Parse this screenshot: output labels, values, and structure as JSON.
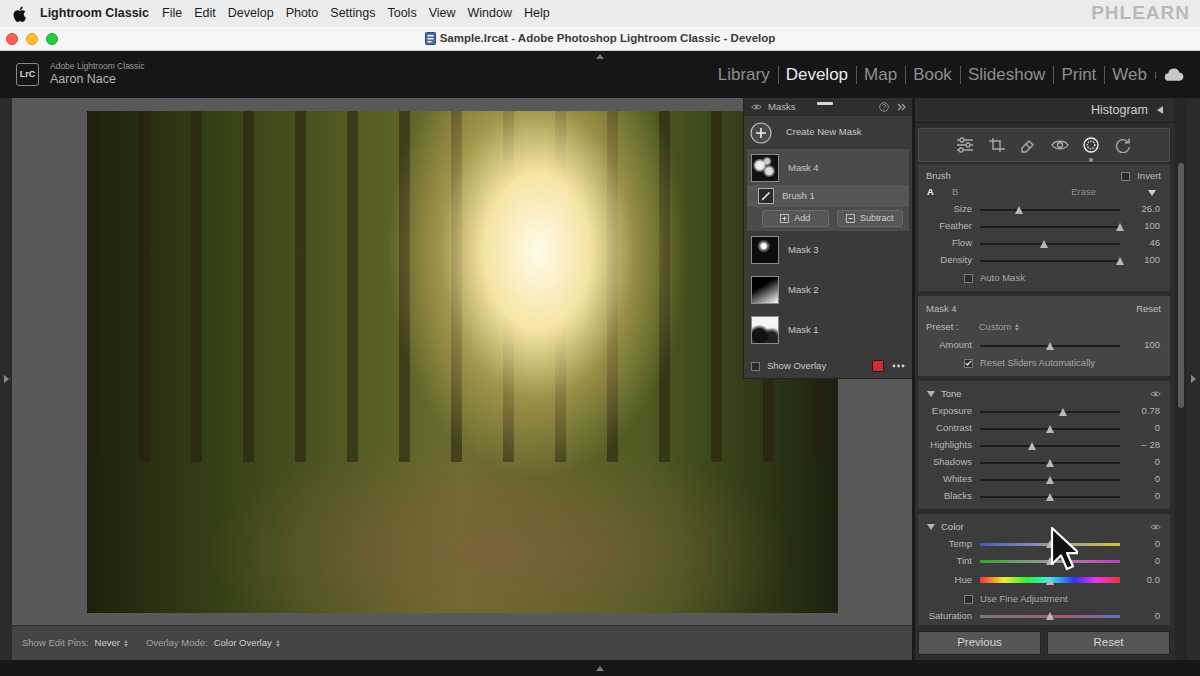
{
  "menubar": {
    "app": "Lightroom Classic",
    "items": [
      "File",
      "Edit",
      "Develop",
      "Photo",
      "Settings",
      "Tools",
      "View",
      "Window",
      "Help"
    ],
    "watermark": "PHLEARN"
  },
  "window": {
    "title": "Sample.lrcat - Adobe Photoshop Lightroom Classic - Develop"
  },
  "identity": {
    "logo": "LrC",
    "product": "Adobe Lightroom Classic",
    "user": "Aaron Nace"
  },
  "modules": [
    {
      "label": "Library",
      "selected": false
    },
    {
      "label": "Develop",
      "selected": true
    },
    {
      "label": "Map",
      "selected": false
    },
    {
      "label": "Book",
      "selected": false
    },
    {
      "label": "Slideshow",
      "selected": false
    },
    {
      "label": "Print",
      "selected": false
    },
    {
      "label": "Web",
      "selected": false
    }
  ],
  "masks_panel": {
    "title": "Masks",
    "create": "Create New Mask",
    "masks": [
      {
        "name": "Mask 4",
        "selected": true,
        "components": [
          {
            "name": "Brush 1",
            "selected": true
          }
        ]
      },
      {
        "name": "Mask 3",
        "selected": false,
        "components": []
      },
      {
        "name": "Mask 2",
        "selected": false,
        "components": []
      },
      {
        "name": "Mask 1",
        "selected": false,
        "components": []
      }
    ],
    "add": "Add",
    "subtract": "Subtract",
    "show_overlay": {
      "label": "Show Overlay",
      "checked": false
    }
  },
  "toolbar": {
    "pins_label": "Show Edit Pins:",
    "pins_value": "Never",
    "overlay_label": "Overlay Mode:",
    "overlay_value": "Color Overlay"
  },
  "right_panel": {
    "histogram": "Histogram",
    "tools": [
      {
        "selected": false
      },
      {
        "selected": false
      },
      {
        "selected": false
      },
      {
        "selected": false
      },
      {
        "selected": true
      },
      {
        "selected": false
      }
    ],
    "brush": {
      "title": "Brush",
      "invert": {
        "label": "Invert",
        "checked": false
      },
      "modes": [
        {
          "label": "A",
          "selected": true
        },
        {
          "label": "B",
          "selected": false
        }
      ],
      "erase": "Erase",
      "sliders": [
        {
          "label": "Size",
          "value": "26.0",
          "level": 0.28,
          "kind": "plain"
        },
        {
          "label": "Feather",
          "value": "100",
          "level": 1.0,
          "kind": "plain"
        },
        {
          "label": "Flow",
          "value": "46",
          "level": 0.46,
          "kind": "plain"
        },
        {
          "label": "Density",
          "value": "100",
          "level": 1.0,
          "kind": "plain"
        }
      ],
      "auto_mask": {
        "label": "Auto Mask",
        "checked": false
      }
    },
    "mask": {
      "title": "Mask 4",
      "reset": "Reset",
      "preset_label": "Preset :",
      "preset_value": "Custom",
      "sliders": [
        {
          "label": "Amount",
          "value": "100",
          "level": 0.5,
          "kind": "plain"
        }
      ],
      "reset_sliders": {
        "label": "Reset Sliders Automatically",
        "checked": true
      }
    },
    "sections": [
      {
        "title": "Tone",
        "expanded": true,
        "rows": [
          {
            "kind": "plain",
            "label": "Exposure",
            "value": "0.78",
            "level": 0.59
          },
          {
            "kind": "plain",
            "label": "Contrast",
            "value": "0",
            "level": 0.5
          },
          {
            "kind": "plain",
            "label": "Highlights",
            "value": "– 28",
            "level": 0.37
          },
          {
            "kind": "plain",
            "label": "Shadows",
            "value": "0",
            "level": 0.5
          },
          {
            "kind": "plain",
            "label": "Whites",
            "value": "0",
            "level": 0.5
          },
          {
            "kind": "plain",
            "label": "Blacks",
            "value": "0",
            "level": 0.5
          }
        ]
      },
      {
        "title": "Color",
        "expanded": true,
        "rows": [
          {
            "kind": "temp",
            "label": "Temp",
            "value": "0",
            "level": 0.5
          },
          {
            "kind": "tint",
            "label": "Tint",
            "value": "0",
            "level": 0.5
          },
          {
            "kind": "hue",
            "label": "Hue",
            "value": "0.0",
            "level": 0.5
          },
          {
            "kind": "checkbox",
            "label": "Use Fine Adjustment",
            "checked": false
          },
          {
            "kind": "saturation",
            "label": "Saturation",
            "value": "0",
            "level": 0.5
          }
        ]
      }
    ]
  },
  "buttons": [
    {
      "label": "Previous"
    },
    {
      "label": "Reset"
    }
  ]
}
